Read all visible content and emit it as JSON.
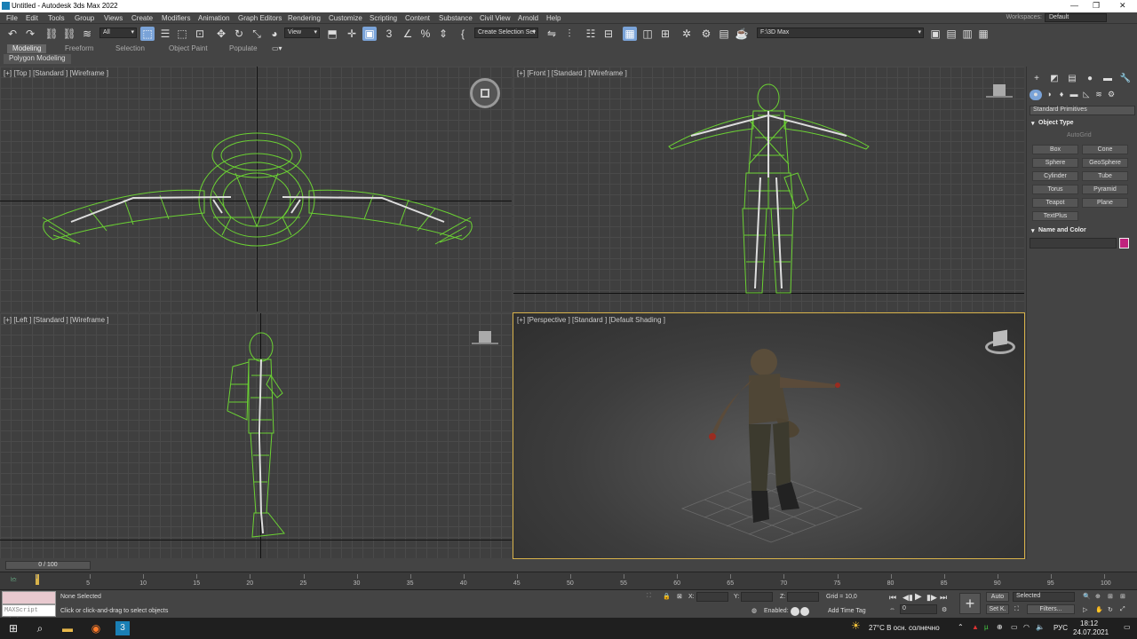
{
  "window": {
    "title": "Untitled - Autodesk 3ds Max 2022"
  },
  "menu": [
    "File",
    "Edit",
    "Tools",
    "Group",
    "Views",
    "Create",
    "Modifiers",
    "Animation",
    "Graph Editors",
    "Rendering",
    "Customize",
    "Scripting",
    "Content",
    "Substance",
    "Civil View",
    "Arnold",
    "Help"
  ],
  "workspace": {
    "label": "Workspaces:",
    "value": "Default"
  },
  "toolbar": {
    "filter": "All",
    "refcoord": "View",
    "selection_set": "Create Selection Set",
    "path": "F:\\3D Max",
    "snap_labels": [
      "3",
      "%"
    ]
  },
  "ribbon": {
    "tabs": [
      "Modeling",
      "Freeform",
      "Selection",
      "Object Paint",
      "Populate"
    ],
    "active_tab": "Modeling",
    "panel": "Polygon Modeling"
  },
  "viewports": {
    "top": "[+] [Top ] [Standard ] [Wireframe ]",
    "front": "[+] [Front ] [Standard ] [Wireframe ]",
    "left": "[+] [Left ] [Standard ] [Wireframe ]",
    "perspective": "[+] [Perspective ] [Standard ] [Default Shading ]"
  },
  "command_panel": {
    "category": "Standard Primitives",
    "object_type_title": "Object Type",
    "autogrid": "AutoGrid",
    "buttons": [
      "Box",
      "Cone",
      "Sphere",
      "GeoSphere",
      "Cylinder",
      "Tube",
      "Torus",
      "Pyramid",
      "Teapot",
      "Plane",
      "TextPlus"
    ],
    "name_color_title": "Name and Color",
    "object_color": "#c0237d"
  },
  "timeline": {
    "frame": "0 / 100",
    "ticks": [
      "0",
      "5",
      "10",
      "15",
      "20",
      "25",
      "30",
      "35",
      "40",
      "45",
      "50",
      "55",
      "60",
      "65",
      "70",
      "75",
      "80",
      "85",
      "90",
      "95",
      "100"
    ]
  },
  "status": {
    "maxscript": "MAXScript Mini",
    "selection": "None Selected",
    "prompt": "Click or click-and-drag to select objects",
    "x_label": "X:",
    "y_label": "Y:",
    "z_label": "Z:",
    "grid": "Grid = 10,0",
    "enabled": "Enabled:",
    "add_time_tag": "Add Time Tag",
    "auto": "Auto",
    "setk": "Set K.",
    "selected": "Selected",
    "filters": "Filters...",
    "frame_value": "0"
  },
  "taskbar": {
    "weather": "27°C В осн. солнечно",
    "lang": "РУС",
    "time": "18:12",
    "date": "24.07.2021"
  },
  "colors": {
    "wire": "#6bd233",
    "accent": "#d8b24a",
    "active_tool": "#7aa3d8"
  }
}
